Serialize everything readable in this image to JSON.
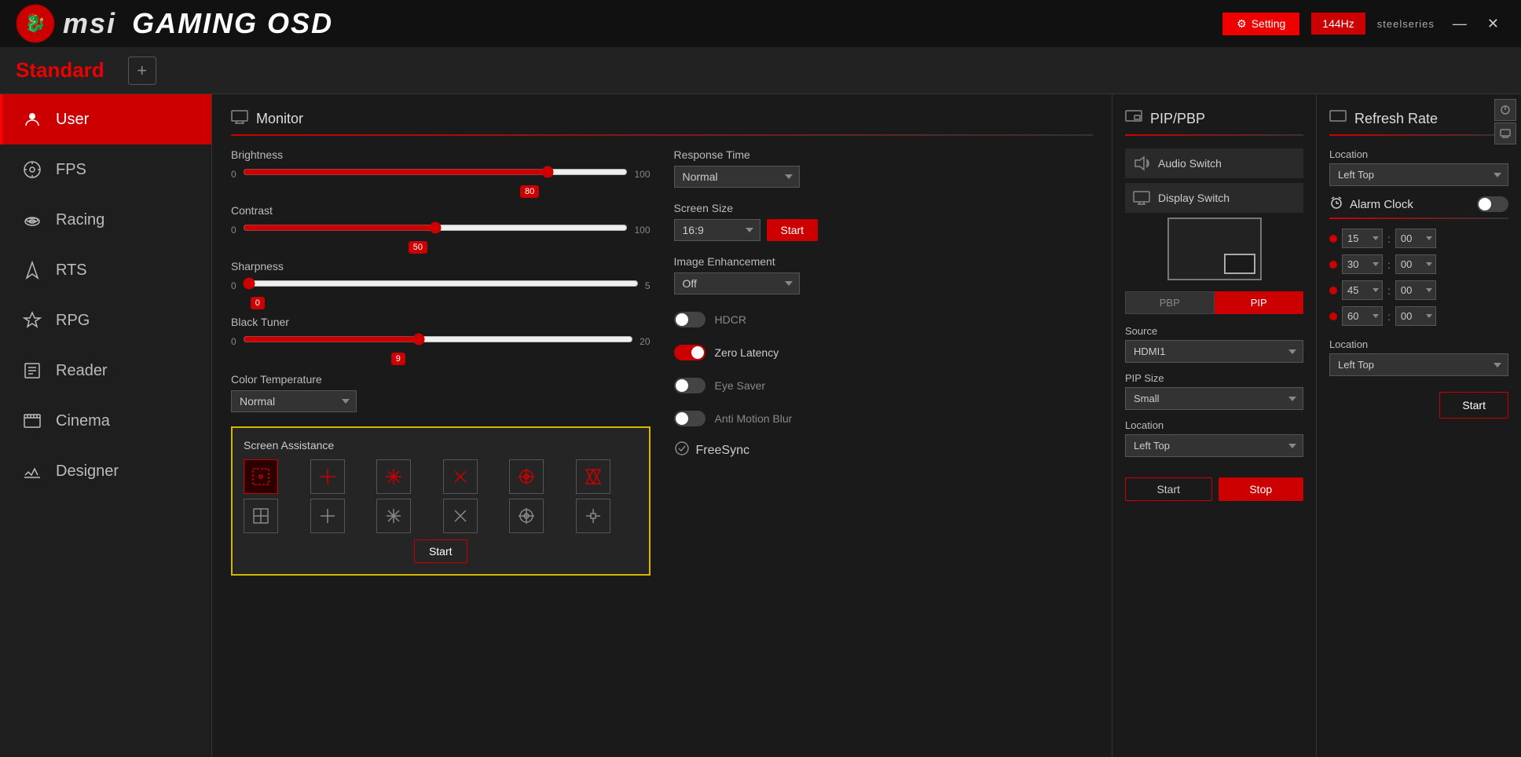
{
  "titlebar": {
    "title": "msi GAMING OSD",
    "setting_label": "Setting",
    "hz_label": "144Hz",
    "steelseries_label": "steelseries",
    "min_btn": "—",
    "close_btn": "✕"
  },
  "profile": {
    "title": "Standard",
    "add_btn": "+"
  },
  "sidebar": {
    "items": [
      {
        "id": "user",
        "label": "User",
        "icon": "👤"
      },
      {
        "id": "fps",
        "label": "FPS",
        "icon": "🎯"
      },
      {
        "id": "racing",
        "label": "Racing",
        "icon": "🚗"
      },
      {
        "id": "rts",
        "label": "RTS",
        "icon": "♟"
      },
      {
        "id": "rpg",
        "label": "RPG",
        "icon": "🛡"
      },
      {
        "id": "reader",
        "label": "Reader",
        "icon": "📖"
      },
      {
        "id": "cinema",
        "label": "Cinema",
        "icon": "🎬"
      },
      {
        "id": "designer",
        "label": "Designer",
        "icon": "✏"
      }
    ],
    "active": "user"
  },
  "monitor": {
    "panel_title": "Monitor",
    "brightness": {
      "label": "Brightness",
      "min": "0",
      "max": "100",
      "value": 80
    },
    "contrast": {
      "label": "Contrast",
      "min": "0",
      "max": "100",
      "value": 50
    },
    "sharpness": {
      "label": "Sharpness",
      "min": "0",
      "max": "5",
      "value": 0
    },
    "black_tuner": {
      "label": "Black Tuner",
      "min": "0",
      "max": "20",
      "value": 9
    },
    "color_temp": {
      "label": "Color Temperature",
      "value": "Normal"
    },
    "response_time": {
      "label": "Response Time",
      "value": "Normal"
    },
    "screen_size": {
      "label": "Screen Size",
      "value": "16:9"
    },
    "image_enhancement": {
      "label": "Image Enhancement",
      "value": "Off"
    },
    "hdcr": {
      "label": "HDCR",
      "enabled": false
    },
    "zero_latency": {
      "label": "Zero Latency",
      "enabled": true
    },
    "eye_saver": {
      "label": "Eye Saver",
      "enabled": false
    },
    "anti_motion_blur": {
      "label": "Anti Motion Blur",
      "enabled": false
    },
    "freesync": {
      "label": "FreeSync"
    },
    "screen_size_start_btn": "Start"
  },
  "screen_assistance": {
    "title": "Screen Assistance",
    "start_btn": "Start",
    "icons": [
      "⊞",
      "+",
      "❖",
      "⋯",
      "⊙",
      "↕",
      "⊡",
      "✛",
      "⊹",
      "⋰",
      "⊕",
      "↔"
    ]
  },
  "pip_pbp": {
    "panel_title": "PIP/PBP",
    "audio_switch": "Audio Switch",
    "display_switch": "Display Switch",
    "pbp_tab": "PBP",
    "pip_tab": "PIP",
    "active_tab": "pip",
    "source_label": "Source",
    "source_value": "HDMI1",
    "pip_size_label": "PIP Size",
    "pip_size_value": "Small",
    "location_label": "Location",
    "location_value": "Left Top",
    "start_btn": "Start",
    "stop_btn": "Stop"
  },
  "refresh_rate": {
    "panel_title": "Refresh Rate",
    "location_label": "Location",
    "location_value": "Left Top",
    "alarm_clock_label": "Alarm Clock",
    "alarm_rows": [
      {
        "hour": "15",
        "minute": "00"
      },
      {
        "hour": "30",
        "minute": "00"
      },
      {
        "hour": "45",
        "minute": "00"
      },
      {
        "hour": "60",
        "minute": "00"
      }
    ],
    "location2_label": "Location",
    "location2_value": "Left Top",
    "start_btn": "Start"
  }
}
